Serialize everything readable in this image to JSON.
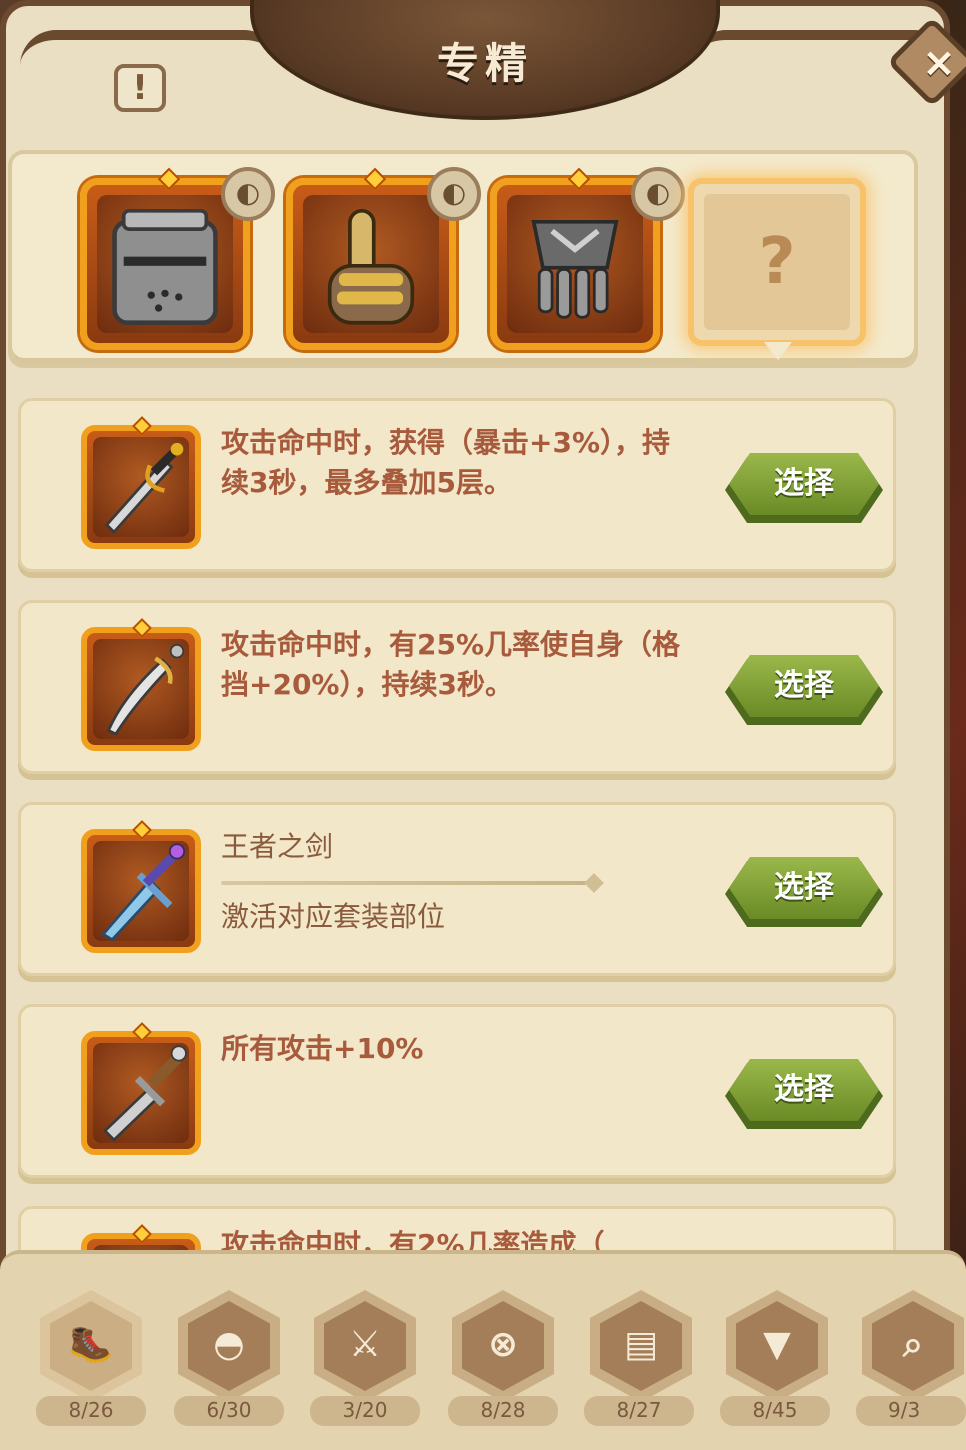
{
  "header": {
    "title": "专精",
    "info_label": "!",
    "close_label": "×"
  },
  "equipment_slots": [
    {
      "icon": "helmet-icon",
      "badge": "◐"
    },
    {
      "icon": "finger-gesture-icon",
      "badge": "◐"
    },
    {
      "icon": "gauntlet-icon",
      "badge": "◐"
    },
    {
      "icon": "unknown-icon",
      "label": "?"
    }
  ],
  "cards": [
    {
      "icon": "short-sword-icon",
      "text": "攻击命中时，获得（暴击+3%），持续3秒，最多叠加5层。",
      "button": "选择"
    },
    {
      "icon": "saber-icon",
      "text": "攻击命中时，有25%几率使自身（格挡+20%），持续3秒。",
      "button": "选择"
    },
    {
      "icon": "kings-sword-icon",
      "title": "王者之剑",
      "subtitle": "激活对应套装部位",
      "button": "选择"
    },
    {
      "icon": "broad-sword-icon",
      "text": "所有攻击+10%",
      "button": "选择"
    },
    {
      "icon": "sword-icon",
      "text": "攻击命中时，有2%几率造成（"
    }
  ],
  "tabs": [
    {
      "icon": "boot-icon",
      "count": "8/26",
      "active": true
    },
    {
      "icon": "drumstick-icon",
      "count": "6/30"
    },
    {
      "icon": "sword-icon",
      "count": "3/20"
    },
    {
      "icon": "cross-shield-icon",
      "count": "8/28"
    },
    {
      "icon": "book-icon",
      "count": "8/27"
    },
    {
      "icon": "armor-icon",
      "count": "8/45"
    },
    {
      "icon": "magnifier-icon",
      "count": "9/3"
    }
  ],
  "colors": {
    "accent_orange": "#f1a01e",
    "select_green": "#7a9a30",
    "parchment": "#f2e7c9",
    "text_red_brown": "#a85a3c"
  }
}
